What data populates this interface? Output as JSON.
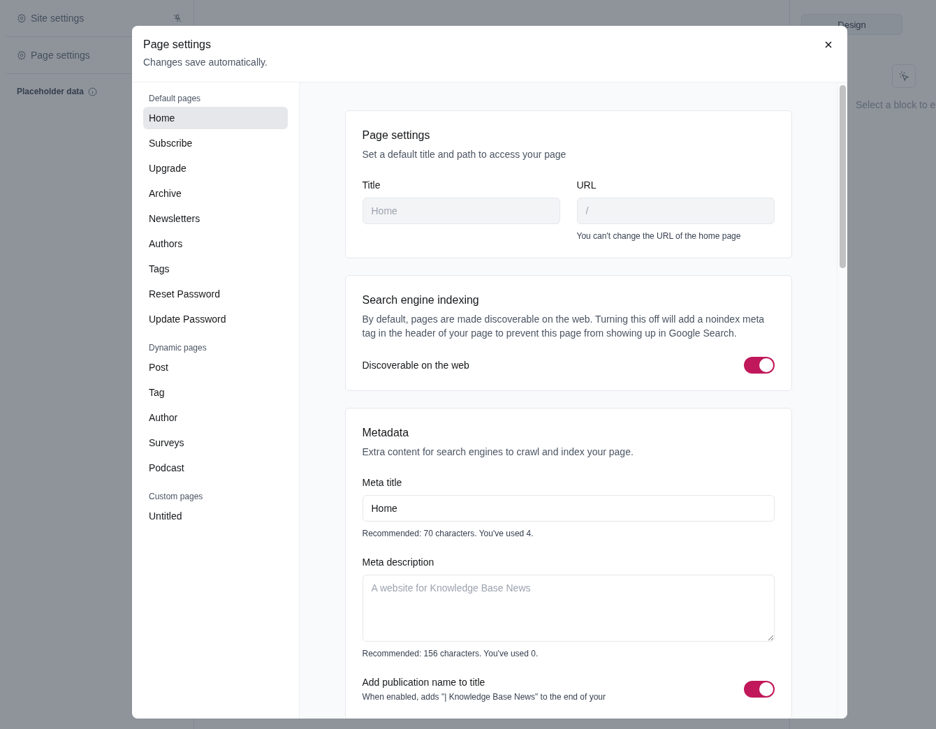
{
  "background": {
    "sidebar_items": [
      "Site settings",
      "Page settings"
    ],
    "placeholder_label": "Placeholder data",
    "tab": "Design",
    "hint": "Select a block to e"
  },
  "dialog": {
    "title": "Page settings",
    "subtitle": "Changes save automatically.",
    "nav_groups": [
      {
        "heading": "Default pages",
        "items": [
          {
            "label": "Home",
            "selected": true
          },
          {
            "label": "Subscribe",
            "selected": false
          },
          {
            "label": "Upgrade",
            "selected": false
          },
          {
            "label": "Archive",
            "selected": false
          },
          {
            "label": "Newsletters",
            "selected": false
          },
          {
            "label": "Authors",
            "selected": false
          },
          {
            "label": "Tags",
            "selected": false
          },
          {
            "label": "Reset Password",
            "selected": false
          },
          {
            "label": "Update Password",
            "selected": false
          }
        ]
      },
      {
        "heading": "Dynamic pages",
        "items": [
          {
            "label": "Post",
            "selected": false
          },
          {
            "label": "Tag",
            "selected": false
          },
          {
            "label": "Author",
            "selected": false
          },
          {
            "label": "Surveys",
            "selected": false
          },
          {
            "label": "Podcast",
            "selected": false
          }
        ]
      },
      {
        "heading": "Custom pages",
        "items": [
          {
            "label": "Untitled",
            "selected": false
          }
        ]
      }
    ],
    "page_settings": {
      "title": "Page settings",
      "description": "Set a default title and path to access your page",
      "fields": [
        {
          "label": "Title",
          "placeholder": "Home",
          "disabled": true
        },
        {
          "label": "URL",
          "placeholder": "/",
          "disabled": true,
          "help": "You can't change the URL of the home page"
        }
      ]
    },
    "indexing": {
      "title": "Search engine indexing",
      "description": "By default, pages are made discoverable on the web. Turning this off will add a noindex meta tag in the header of your page to prevent this page from showing up in Google Search.",
      "toggle_label": "Discoverable on the web",
      "on": true
    },
    "metadata": {
      "title": "Metadata",
      "description": "Extra content for search engines to crawl and index your page.",
      "meta_title": {
        "label": "Meta title",
        "value": "Home",
        "help": "Recommended: 70 characters. You've used 4."
      },
      "meta_description": {
        "label": "Meta description",
        "placeholder": "A website for Knowledge Base News",
        "help": "Recommended: 156 characters. You've used 0."
      },
      "publication_toggle": {
        "label": "Add publication name to title",
        "description": "When enabled, adds \"| Knowledge Base News\" to the end of your",
        "on": true
      }
    }
  }
}
